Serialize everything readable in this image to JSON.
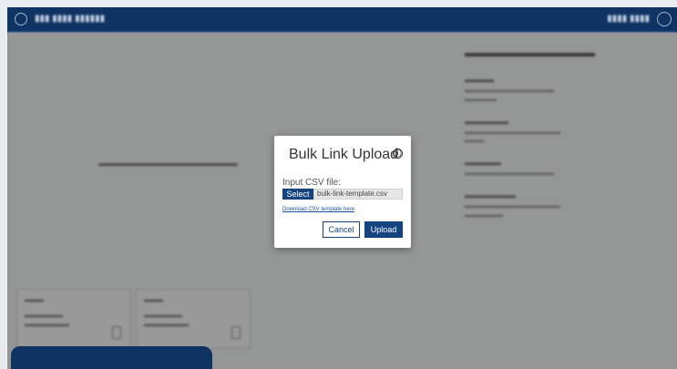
{
  "modal": {
    "title": "Bulk Link Upload",
    "info_icon": "ⓘ",
    "input_label": "Input CSV file:",
    "select_label": "Select",
    "file_name": "bulk-link-template.csv",
    "download_link": "Download CSV template here",
    "cancel_label": "Cancel",
    "upload_label": "Upload"
  },
  "colors": {
    "primary": "#14447f",
    "topbar": "#0f3463",
    "link": "#1a4fa0"
  },
  "icons": [
    "app-logo-icon",
    "user-avatar-icon",
    "info-icon",
    "file-icon"
  ]
}
